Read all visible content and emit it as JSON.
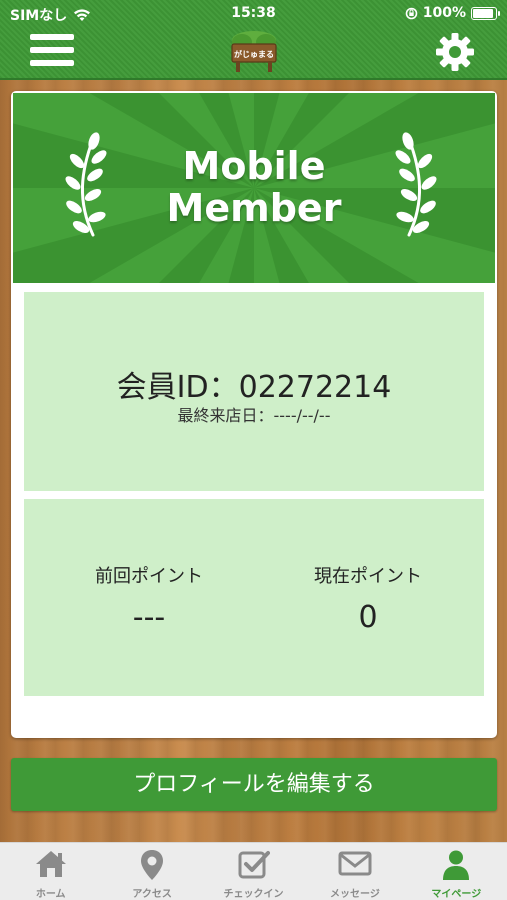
{
  "status": {
    "carrier": "SIMなし",
    "time": "15:38",
    "battery_percent": "100%",
    "battery_level": 1.0
  },
  "header": {
    "menu_icon": "hamburger-menu-icon",
    "logo_text": "がじゅまる",
    "settings_icon": "gear-icon",
    "brand_color": "#3f9a37"
  },
  "banner": {
    "line1": "Mobile",
    "line2": "Member"
  },
  "member": {
    "id_line": "会員ID：02272214",
    "last_visit_line": "最終来店日：----/--/--"
  },
  "points": {
    "previous_label": "前回ポイント",
    "previous_value": "---",
    "current_label": "現在ポイント",
    "current_value": "0"
  },
  "edit_profile_label": "プロフィールを編集する",
  "tabs": [
    {
      "label": "ホーム",
      "icon": "home-icon"
    },
    {
      "label": "アクセス",
      "icon": "map-pin-icon"
    },
    {
      "label": "チェックイン",
      "icon": "checkbox-icon"
    },
    {
      "label": "メッセージ",
      "icon": "envelope-icon"
    },
    {
      "label": "マイページ",
      "icon": "person-icon",
      "active": true
    }
  ]
}
